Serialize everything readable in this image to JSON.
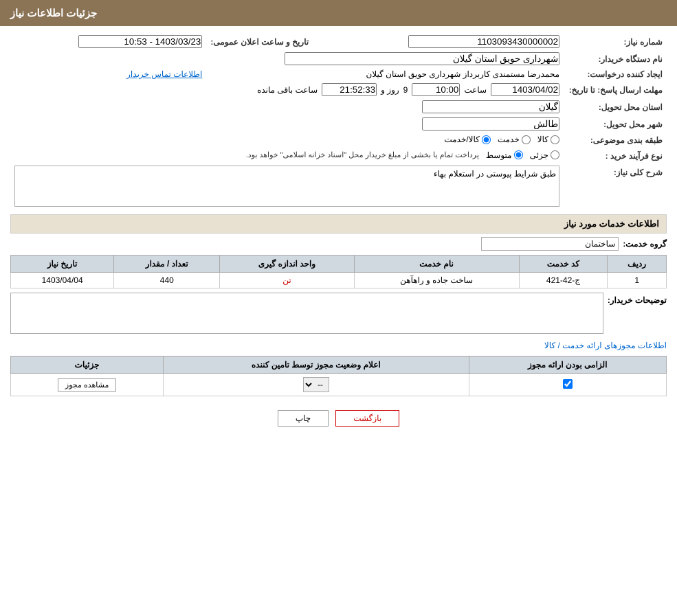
{
  "header": {
    "title": "جزئیات اطلاعات نیاز"
  },
  "fields": {
    "need_number_label": "شماره نیاز:",
    "need_number_value": "1103093430000002",
    "buyer_org_label": "نام دستگاه خریدار:",
    "buyer_org_value": "شهرداری حویق استان گیلان",
    "date_time_label": "تاریخ و ساعت اعلان عمومی:",
    "date_time_value": "1403/03/23 - 10:53",
    "creator_label": "ایجاد کننده درخواست:",
    "creator_value": "محمدرضا مستمندی کاربرداز شهرداری حویق استان گیلان",
    "contact_link": "اطلاعات تماس خریدار",
    "reply_deadline_label": "مهلت ارسال پاسخ: تا تاریخ:",
    "reply_date": "1403/04/02",
    "reply_time_label": "ساعت",
    "reply_time": "10:00",
    "reply_day_label": "روز و",
    "reply_days": "9",
    "reply_remaining_label": "ساعت باقی مانده",
    "reply_remaining": "21:52:33",
    "province_label": "استان محل تحویل:",
    "province_value": "گیلان",
    "city_label": "شهر محل تحویل:",
    "city_value": "طالش",
    "category_label": "طبقه بندی موضوعی:",
    "category_kala": "کالا",
    "category_khedmat": "خدمت",
    "category_kala_khedmat": "کالا/خدمت",
    "purchase_type_label": "نوع فرآیند خرید :",
    "purchase_partial": "جزئی",
    "purchase_medium": "متوسط",
    "purchase_desc": "پرداخت تمام یا بخشی از مبلغ خریدار محل \"اسناد خزانه اسلامی\" خواهد بود.",
    "general_desc_label": "شرح کلی نیاز:",
    "general_desc_value": "طبق شرایط پیوستی در استعلام بهاء"
  },
  "service_info": {
    "section_title": "اطلاعات خدمات مورد نیاز",
    "group_label": "گروه خدمت:",
    "group_value": "ساختمان",
    "table": {
      "headers": [
        "ردیف",
        "کد خدمت",
        "نام خدمت",
        "واحد اندازه گیری",
        "تعداد / مقدار",
        "تاریخ نیاز"
      ],
      "rows": [
        {
          "row_num": "1",
          "service_code": "ج-42-421",
          "service_name": "ساخت جاده و راهآهن",
          "unit": "تن",
          "quantity": "440",
          "date": "1403/04/04"
        }
      ]
    }
  },
  "buyer_notes": {
    "label": "توضیحات خریدار:",
    "value": ""
  },
  "permits": {
    "link_text": "اطلاعات مجوزهای ارائه خدمت / کالا",
    "table": {
      "headers": [
        "الزامی بودن ارائه مجوز",
        "اعلام وضعیت مجوز توسط تامین کننده",
        "جزئیات"
      ],
      "rows": [
        {
          "required": true,
          "status": "--",
          "detail_btn": "مشاهده مجوز"
        }
      ]
    }
  },
  "buttons": {
    "print": "چاپ",
    "back": "بازگشت"
  }
}
